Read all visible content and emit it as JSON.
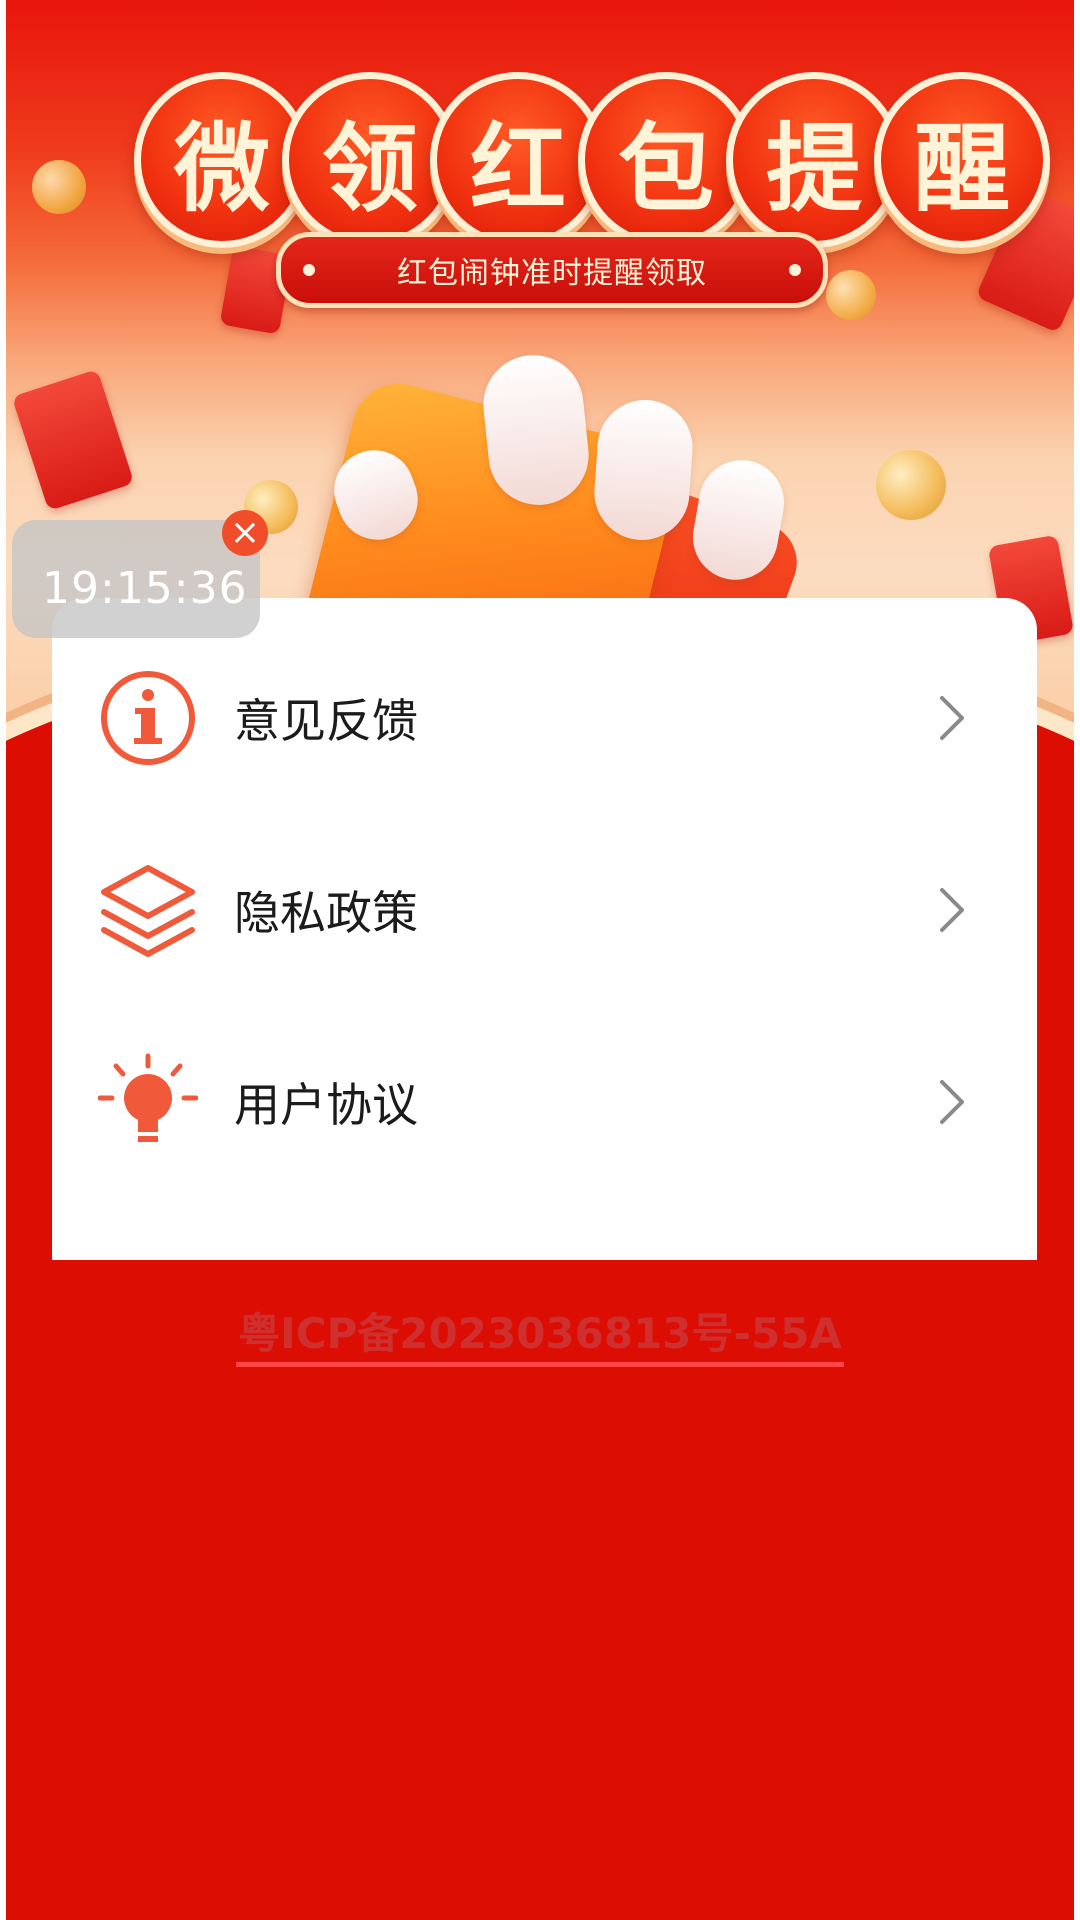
{
  "header": {
    "title_chars": [
      "微",
      "领",
      "红",
      "包",
      "提",
      "醒"
    ],
    "subtitle": "红包闹钟准时提醒领取"
  },
  "time_widget": {
    "time": "19:15:36",
    "close_icon": "close-icon"
  },
  "menu": {
    "items": [
      {
        "label": "意见反馈",
        "icon": "info-icon"
      },
      {
        "label": "隐私政策",
        "icon": "layers-icon"
      },
      {
        "label": "用户协议",
        "icon": "lightbulb-icon"
      }
    ],
    "arrow_icon": "chevron-right-icon"
  },
  "footer": {
    "icp": "粤ICP备2023036813号-55A"
  },
  "colors": {
    "background": "#dc0d02",
    "accent": "#f05a3a",
    "card": "#ffffff"
  }
}
